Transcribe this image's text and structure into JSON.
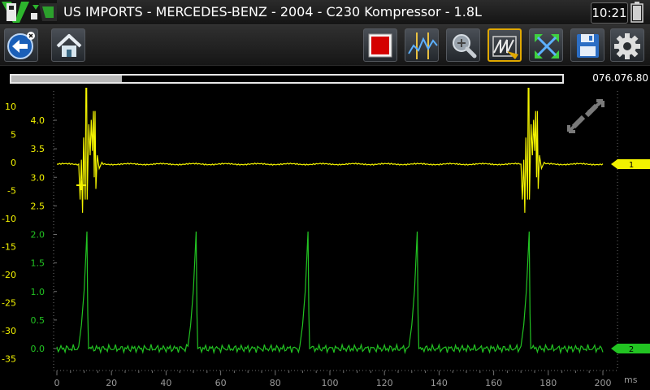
{
  "header": {
    "title": "US IMPORTS - MERCEDES-BENZ - 2004 - C230 Kompressor - 1.8L",
    "clock": "10:21",
    "logo_letter": "V"
  },
  "toolbar": {
    "buttons": [
      {
        "name": "back-button",
        "icon": "back-arrow-icon"
      },
      {
        "name": "home-button",
        "icon": "home-icon"
      },
      {
        "name": "stop-record-button",
        "icon": "stop-record-icon"
      },
      {
        "name": "cursors-button",
        "icon": "cursors-icon"
      },
      {
        "name": "zoom-button",
        "icon": "magnifier-icon"
      },
      {
        "name": "trigger-button",
        "icon": "trigger-icon",
        "selected": true
      },
      {
        "name": "fit-screen-button",
        "icon": "fit-screen-icon"
      },
      {
        "name": "save-button",
        "icon": "floppy-disk-icon"
      },
      {
        "name": "settings-button",
        "icon": "gear-icon"
      }
    ]
  },
  "progress": {
    "fraction": 0.2,
    "counter": "076.076.80"
  },
  "colors": {
    "channel1": "#f2f200",
    "channel2": "#22c322",
    "grid": "#6f6f6f",
    "stop_red": "#d40000"
  },
  "chart_data": {
    "type": "line",
    "x_unit": "ms",
    "xlim": [
      0,
      200
    ],
    "x_ticks": [
      "0",
      "20",
      "40",
      "60",
      "80",
      "100",
      "120",
      "140",
      "160",
      "180",
      "200"
    ],
    "left_axis_ticks": [
      "10",
      "5",
      "0",
      "-5",
      "-10",
      "-15",
      "-20",
      "-25",
      "-30",
      "-35"
    ],
    "ch1_axis_ticks": [
      "4.0",
      "3.5",
      "3.0",
      "2.5",
      "2.0",
      "1.5",
      "1.0",
      "0.5",
      "0.0"
    ],
    "series": [
      {
        "name": "1",
        "color": "#f2f200",
        "baseline": 3.0,
        "events_ms": [
          12,
          174
        ]
      },
      {
        "name": "2",
        "color": "#22c322",
        "baseline": 0.0,
        "pulse_peak": 1.0,
        "pulses_ms": [
          11,
          51,
          92,
          132,
          173
        ]
      }
    ]
  }
}
